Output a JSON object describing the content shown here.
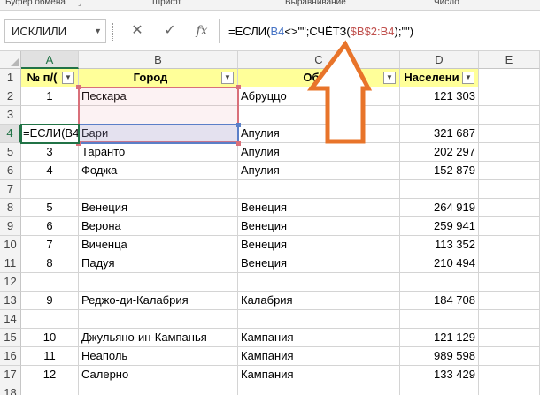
{
  "ribbon": {
    "groups": [
      "Буфер обмена",
      "Шрифт",
      "Выравнивание",
      "Число"
    ]
  },
  "formula_bar": {
    "name_box": "ИСКЛИЛИ",
    "cancel_icon": "close-icon",
    "enter_icon": "check-icon",
    "fx_label": "fx",
    "formula_parts": [
      "=ЕСЛИ(",
      "B4",
      "<>\"\";СЧЁТЗ(",
      "$B$2:B4",
      ");\"\")"
    ]
  },
  "columns": [
    "A",
    "B",
    "C",
    "D",
    "E"
  ],
  "rows": [
    "1",
    "2",
    "3",
    "4",
    "5",
    "6",
    "7",
    "8",
    "9",
    "10",
    "11",
    "12",
    "13",
    "14",
    "15",
    "16",
    "17",
    "18"
  ],
  "table": {
    "headers": [
      "№ п/(",
      "Город",
      "Об",
      "Населени"
    ],
    "data": [
      [
        "1",
        "Пескара",
        "Абруццо",
        "121 303"
      ],
      [
        "",
        "",
        "",
        ""
      ],
      [
        "=ЕСЛИ(B4",
        "Бари",
        "Апулия",
        "321 687"
      ],
      [
        "3",
        "Таранто",
        "Апулия",
        "202 297"
      ],
      [
        "4",
        "Фоджа",
        "Апулия",
        "152 879"
      ],
      [
        "",
        "",
        "",
        ""
      ],
      [
        "5",
        "Венеция",
        "Венеция",
        "264 919"
      ],
      [
        "6",
        "Верона",
        "Венеция",
        "259 941"
      ],
      [
        "7",
        "Виченца",
        "Венеция",
        "113 352"
      ],
      [
        "8",
        "Падуя",
        "Венеция",
        "210 494"
      ],
      [
        "",
        "",
        "",
        ""
      ],
      [
        "9",
        "Реджо-ди-Калабрия",
        "Калабрия",
        "184 708"
      ],
      [
        "",
        "",
        "",
        ""
      ],
      [
        "10",
        "Джульяно-ин-Кампанья",
        "Кампания",
        "121 129"
      ],
      [
        "11",
        "Неаполь",
        "Кампания",
        "989 598"
      ],
      [
        "12",
        "Салерно",
        "Кампания",
        "133 429"
      ],
      [
        "",
        "",
        "",
        ""
      ]
    ]
  },
  "colors": {
    "accent": "#217346",
    "header_fill": "#ffff99",
    "arrow": "#e8742a",
    "ref_blue": "#4472c4",
    "ref_red": "#c0504d"
  }
}
